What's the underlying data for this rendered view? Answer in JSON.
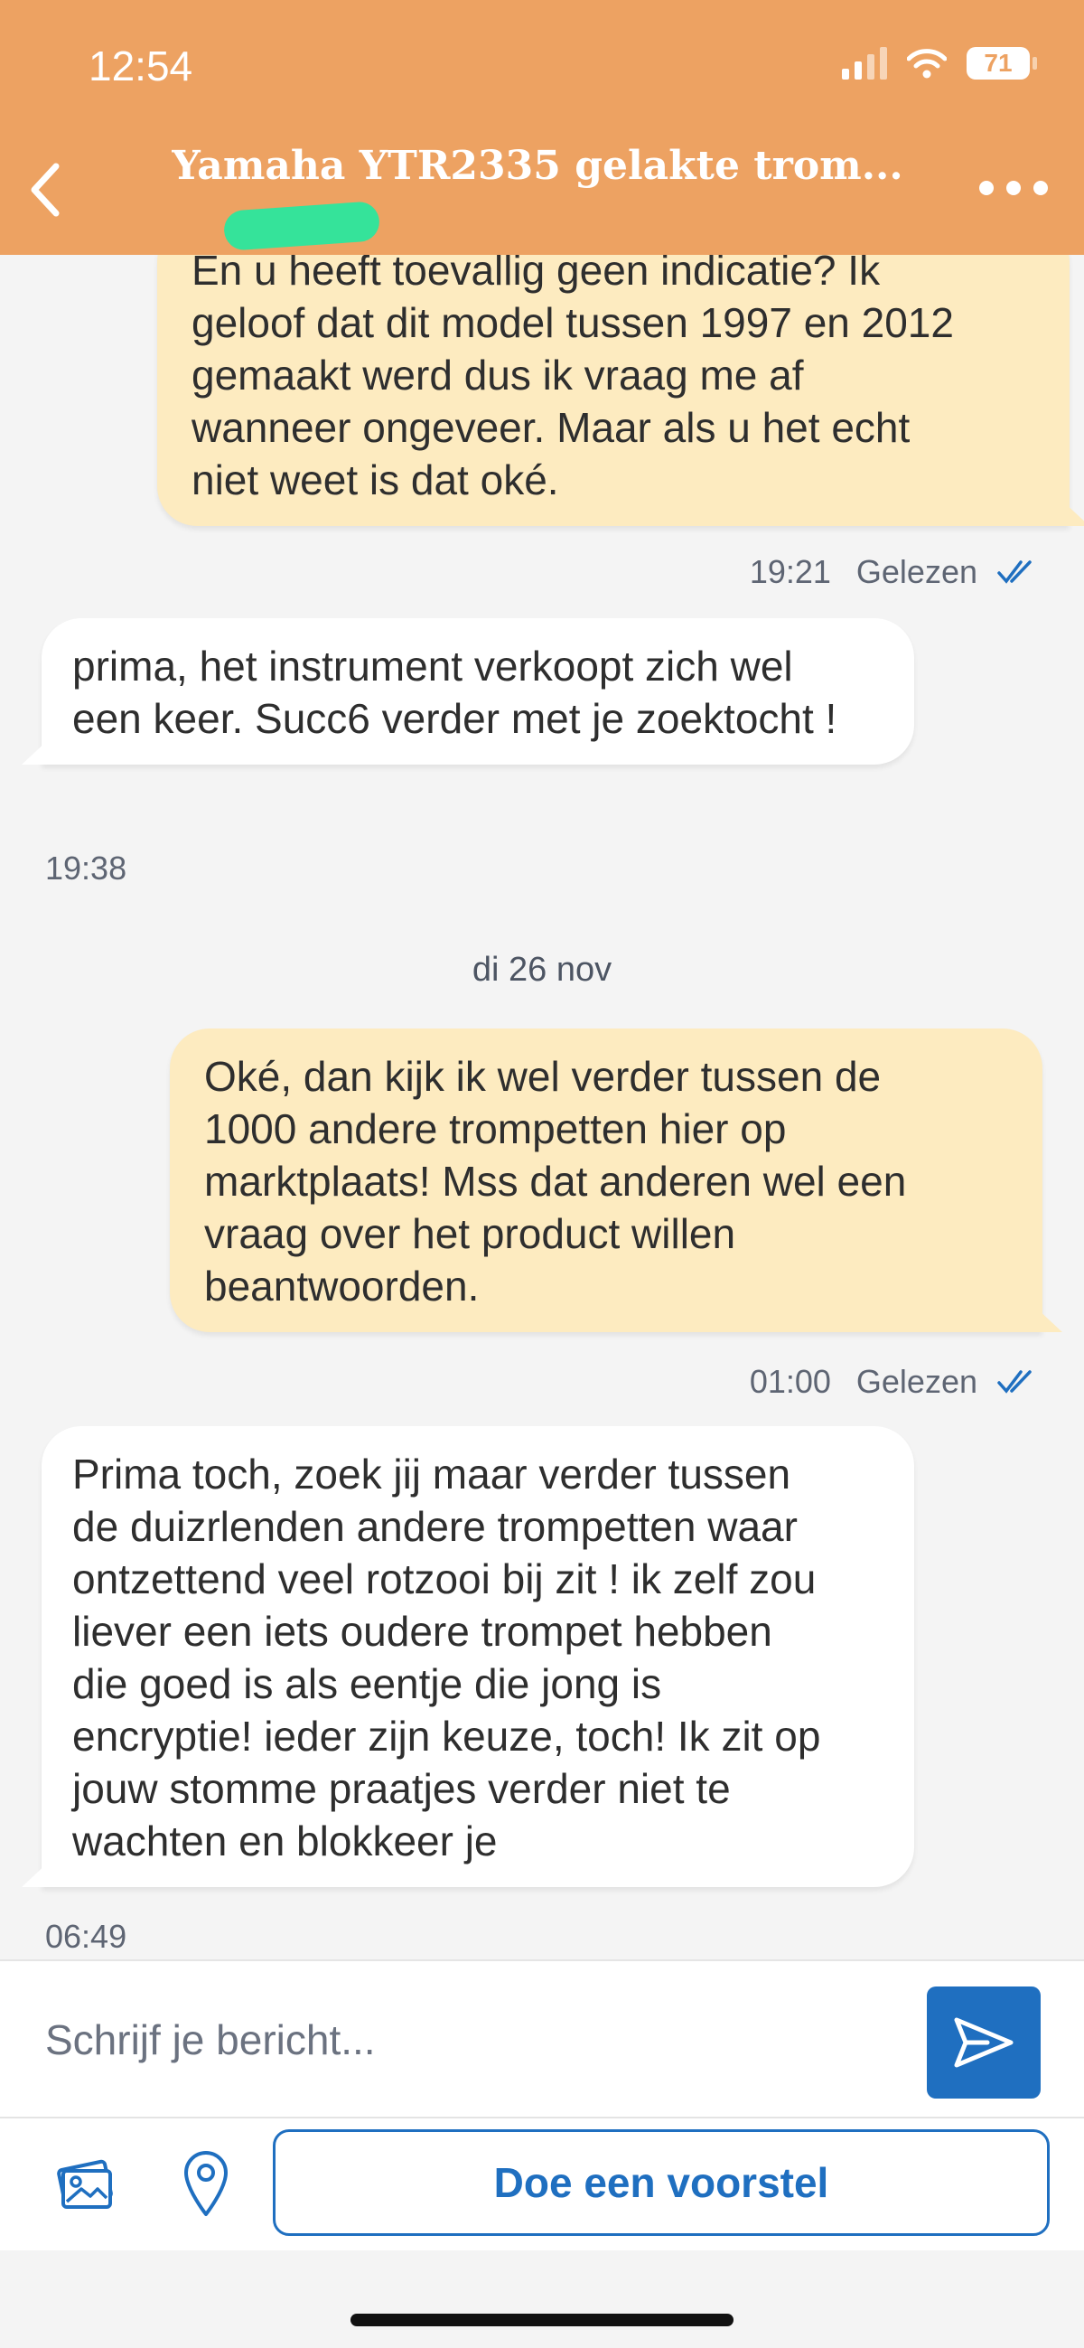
{
  "status_bar": {
    "time": "12:54",
    "battery": "71"
  },
  "header": {
    "title": "Yamaha YTR2335 gelakte trom..."
  },
  "messages": [
    {
      "direction": "out",
      "lines": [
        "En u heeft toevallig geen indicatie? Ik",
        "geloof dat dit model tussen 1997 en 2012",
        "gemaakt werd dus ik vraag me af",
        "wanneer ongeveer. Maar als u het echt",
        "niet weet is dat oké."
      ],
      "time": "19:21",
      "status": "Gelezen"
    },
    {
      "direction": "in",
      "lines": [
        "prima, het instrument verkoopt zich wel",
        "een keer. Succ6 verder met je zoektocht !"
      ],
      "time": "19:38"
    },
    {
      "direction": "out",
      "lines": [
        "Oké, dan kijk ik wel verder tussen de",
        "1000 andere trompetten hier op",
        "marktplaats! Mss dat anderen wel een",
        "vraag over het product willen",
        "beantwoorden."
      ],
      "time": "01:00",
      "status": "Gelezen"
    },
    {
      "direction": "in",
      "lines": [
        "Prima toch, zoek jij maar verder tussen",
        "de duizrlenden andere trompetten waar",
        "ontzettend veel rotzooi bij zit ! ik zelf zou",
        "liever een iets oudere trompet hebben",
        "die goed is als eentje die jong is",
        "encryptie! ieder zijn keuze, toch! Ik zit op",
        "jouw stomme praatjes verder niet te",
        "wachten en blokkeer je"
      ],
      "time": "06:49"
    }
  ],
  "date_separator": "di 26 nov",
  "composer": {
    "placeholder": "Schrijf je bericht...",
    "offer_label": "Doe een voorstel"
  },
  "colors": {
    "header": "#eda262",
    "outgoing_bubble": "#fdebc0",
    "incoming_bubble": "#ffffff",
    "accent": "#1f6fc0",
    "highlight": "#35e39a"
  },
  "icons": {
    "back": "chevron-left-icon",
    "more": "more-dots-icon",
    "read": "double-check-icon",
    "send": "send-icon",
    "image": "image-icon",
    "location": "location-pin-icon"
  }
}
